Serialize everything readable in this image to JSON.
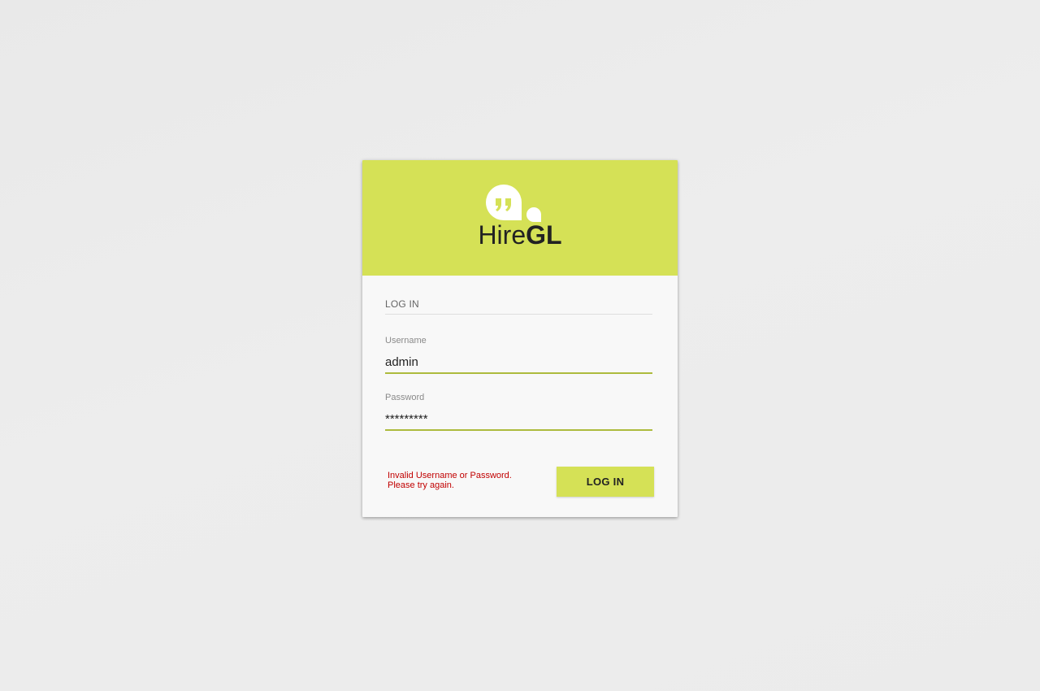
{
  "brand": {
    "name_light": "Hire",
    "name_bold": "GL",
    "logo_icon": "quote-bubble-icon",
    "accent_color": "#d5e156"
  },
  "login": {
    "section_title": "LOG IN",
    "username": {
      "label": "Username",
      "value": "admin"
    },
    "password": {
      "label": "Password",
      "value": "*********"
    },
    "error": {
      "line1": "Invalid Username or Password.",
      "line2": "Please try again.",
      "color": "#c10000"
    },
    "submit_label": "LOG IN"
  }
}
